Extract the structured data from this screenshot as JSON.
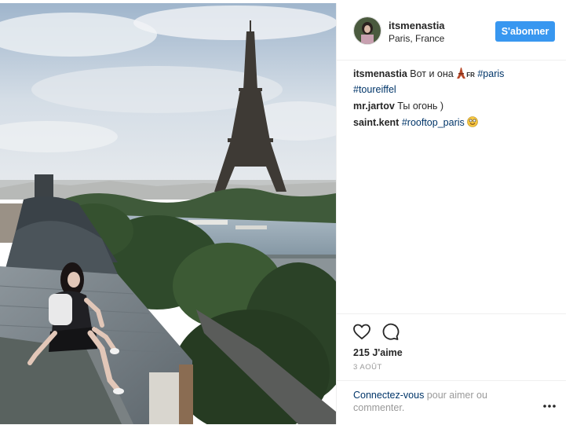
{
  "post": {
    "username": "itsmenastia",
    "location": "Paris, France",
    "follow_label": "S'abonner",
    "likes": "215 J'aime",
    "date": "3 AOÛT",
    "login_link": "Connectez-vous",
    "login_rest": " pour aimer ou commenter."
  },
  "comments": [
    {
      "user": "itsmenastia",
      "text": " Вот и она ",
      "flag": "FR",
      "tags": [
        "#paris",
        "#toureiffel"
      ]
    },
    {
      "user": "mr.jartov",
      "text": " Ты огонь )"
    },
    {
      "user": "saint.kent",
      "tag": "#rooftop_paris"
    }
  ],
  "icons": {
    "like": "heart-icon",
    "comment": "comment-icon",
    "more": "more-dots-icon",
    "tower_emoji": "tower-emoji-icon",
    "smile_emoji": "smile-emoji-icon"
  },
  "colors": {
    "follow_button": "#3897f0",
    "hashtag": "#003569",
    "muted": "#999999"
  }
}
